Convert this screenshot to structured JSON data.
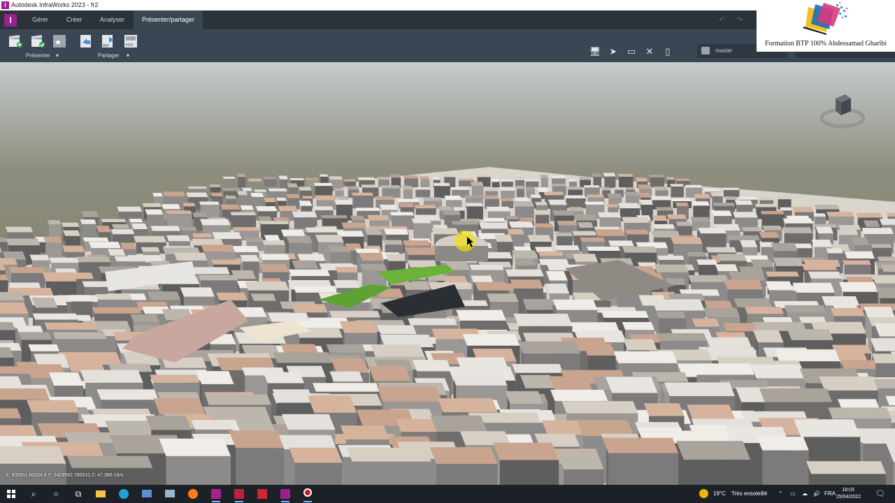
{
  "window": {
    "title": "Autodesk InfraWorks 2023 - fr2",
    "app_icon_letter": "I"
  },
  "ribbon": {
    "tabs": [
      {
        "label": "Gérer",
        "active": false
      },
      {
        "label": "Créer",
        "active": false
      },
      {
        "label": "Analyser",
        "active": false
      },
      {
        "label": "Présenter/partager",
        "active": true
      }
    ],
    "groups": {
      "present": "Présenter",
      "share": "Partager"
    },
    "share_icons": {
      "imx": "IMX",
      "fdo": "FDO"
    },
    "branch": "master"
  },
  "watermark": {
    "text": "Formation BTP 100% Abdessamad Gharibi"
  },
  "viewport": {
    "coordinates": "X: 600911.60034.8 Y: 2429582.780510 Z: 47.386 16m",
    "sky_color": "#b9c0c2",
    "ground_color": "#6e6d55"
  },
  "taskbar": {
    "apps": [
      "windows-start",
      "search",
      "cortana",
      "task-view",
      "file-explorer",
      "edge",
      "control-panel",
      "network-drive",
      "firefox",
      "civil3d",
      "autocad-architecture",
      "autocad",
      "infraworks",
      "obs"
    ],
    "weather": {
      "temp": "19°C",
      "condition": "Très ensoleillé"
    },
    "language": "FRA",
    "time": "18:03",
    "date": "25/04/2022"
  }
}
